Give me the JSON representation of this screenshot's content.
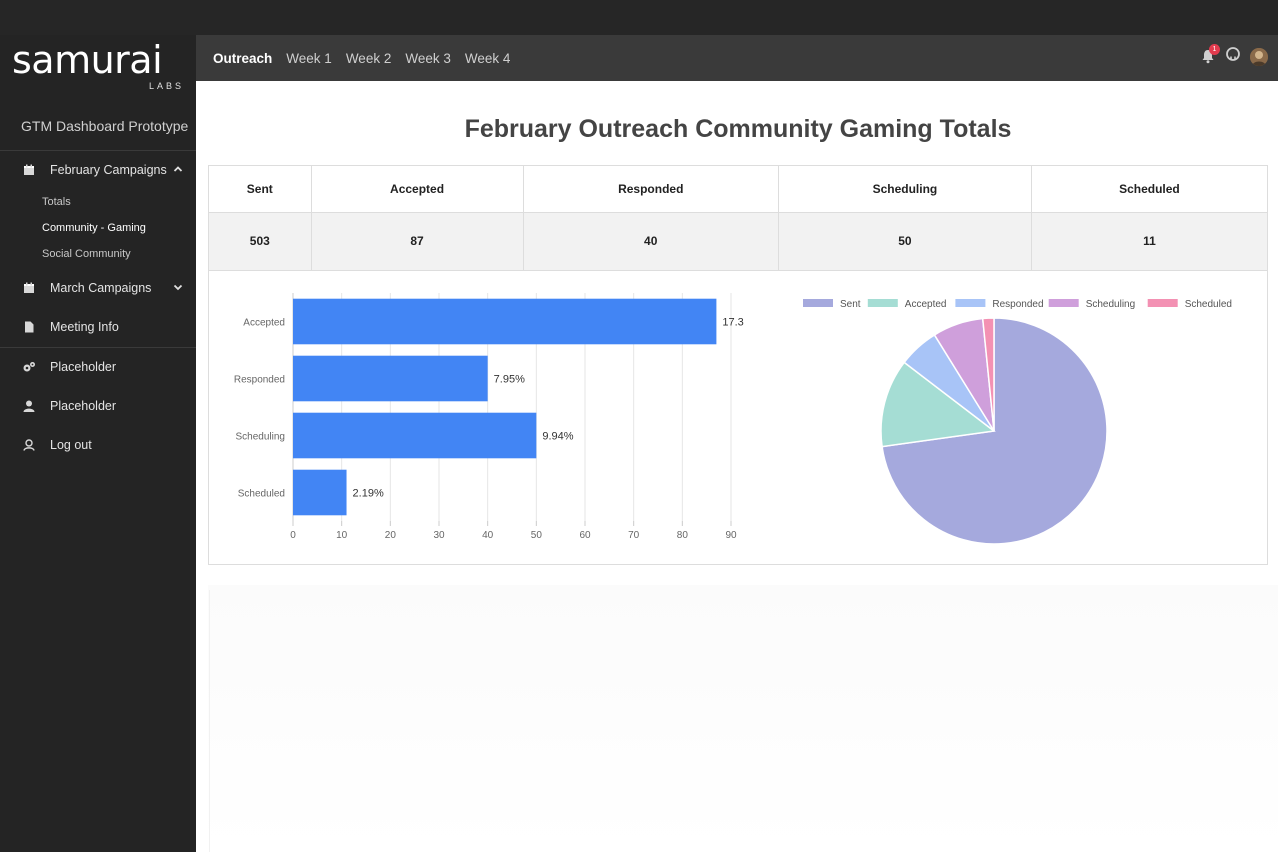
{
  "brand": {
    "name": "samurai",
    "sub": "LABS"
  },
  "sidebar": {
    "app_title": "GTM Dashboard Prototype",
    "items": [
      {
        "label": "February Campaigns",
        "icon": "calendar-icon",
        "expanded": true
      },
      {
        "label": "March Campaigns",
        "icon": "calendar-icon",
        "expanded": false
      },
      {
        "label": "Meeting Info",
        "icon": "file-icon"
      },
      {
        "label": "Placeholder",
        "icon": "gears-icon"
      },
      {
        "label": "Placeholder",
        "icon": "user-icon"
      },
      {
        "label": "Log out",
        "icon": "user-outline-icon"
      }
    ],
    "subitems": [
      {
        "label": "Totals",
        "active": false
      },
      {
        "label": "Community - Gaming",
        "active": true
      },
      {
        "label": "Social Community",
        "active": false
      }
    ]
  },
  "topbar": {
    "tabs": [
      "Outreach",
      "Week 1",
      "Week 2",
      "Week 3",
      "Week 4"
    ],
    "active_tab": "Outreach",
    "notification_count": "1"
  },
  "page": {
    "title": "February Outreach Community Gaming Totals"
  },
  "stats": {
    "headers": [
      "Sent",
      "Accepted",
      "Responded",
      "Scheduling",
      "Scheduled"
    ],
    "values": [
      "503",
      "87",
      "40",
      "50",
      "11"
    ]
  },
  "chart_data": [
    {
      "type": "bar",
      "orientation": "horizontal",
      "categories": [
        "Accepted",
        "Responded",
        "Scheduling",
        "Scheduled"
      ],
      "values": [
        87,
        40,
        50,
        11
      ],
      "data_labels": [
        "17.3",
        "7.95%",
        "9.94%",
        "2.19%"
      ],
      "xlim": [
        0,
        90
      ],
      "xticks": [
        "0",
        "10",
        "20",
        "30",
        "40",
        "50",
        "60",
        "70",
        "80",
        "90"
      ],
      "color": "#4285f4",
      "grid": true
    },
    {
      "type": "pie",
      "labels": [
        "Sent",
        "Accepted",
        "Responded",
        "Scheduling",
        "Scheduled"
      ],
      "values": [
        503,
        87,
        40,
        50,
        11
      ],
      "colors": [
        "#a5a9dd",
        "#a5ddd4",
        "#a8c4f7",
        "#cf9fdb",
        "#f391b3"
      ],
      "legend": "top"
    }
  ]
}
